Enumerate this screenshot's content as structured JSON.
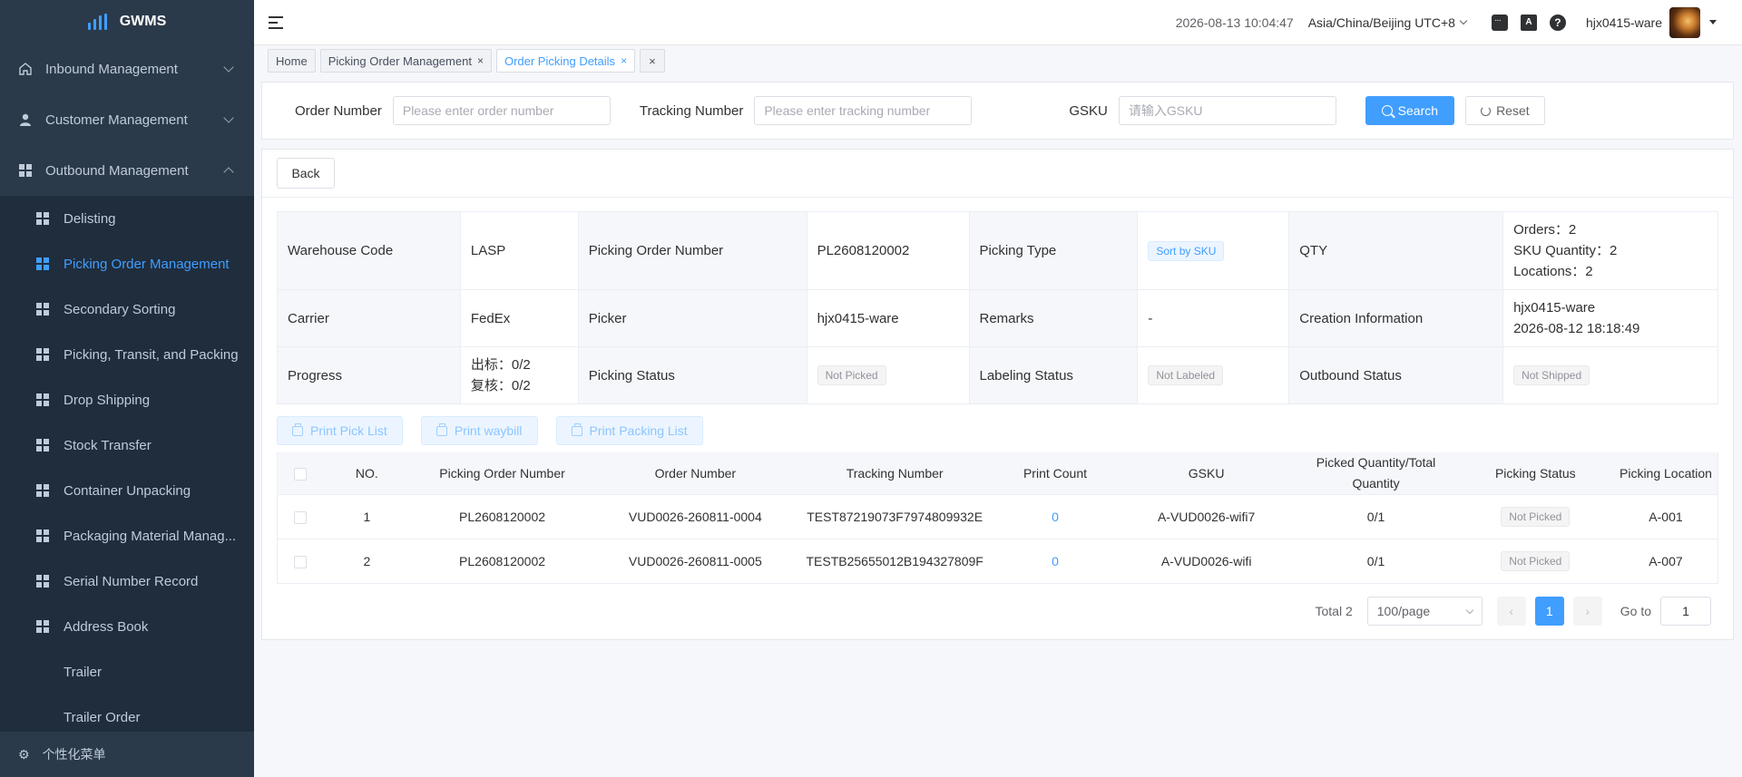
{
  "app": {
    "name": "GWMS"
  },
  "sidebar": {
    "groups": [
      {
        "label": "Inbound Management",
        "expanded": false
      },
      {
        "label": "Customer Management",
        "expanded": false
      },
      {
        "label": "Outbound Management",
        "expanded": true
      }
    ],
    "items": [
      {
        "label": "Delisting",
        "active": false
      },
      {
        "label": "Picking Order Management",
        "active": true
      },
      {
        "label": "Secondary Sorting",
        "active": false
      },
      {
        "label": "Picking, Transit, and Packing",
        "active": false
      },
      {
        "label": "Drop Shipping",
        "active": false
      },
      {
        "label": "Stock Transfer",
        "active": false
      },
      {
        "label": "Container Unpacking",
        "active": false
      },
      {
        "label": "Packaging Material Manag...",
        "active": false
      },
      {
        "label": "Serial Number Record",
        "active": false
      },
      {
        "label": "Address Book",
        "active": false
      },
      {
        "label": "Trailer",
        "active": false
      },
      {
        "label": "Trailer Order",
        "active": false
      }
    ],
    "footer": "个性化菜单"
  },
  "header": {
    "datetime": "2026-08-13 10:04:47",
    "timezone": "Asia/China/Beijing UTC+8",
    "translate_glyph": "A",
    "help_glyph": "?",
    "username": "hjx0415-ware"
  },
  "tabs": [
    {
      "label": "Home",
      "closable": false,
      "active": false
    },
    {
      "label": "Picking Order Management",
      "closable": true,
      "active": false
    },
    {
      "label": "Order Picking Details",
      "closable": true,
      "active": true
    }
  ],
  "close_glyph": "×",
  "search": {
    "order_number": {
      "label": "Order Number",
      "placeholder": "Please enter order number",
      "value": ""
    },
    "tracking_number": {
      "label": "Tracking Number",
      "placeholder": "Please enter tracking number",
      "value": ""
    },
    "gsku": {
      "label": "GSKU",
      "placeholder": "请输入GSKU",
      "value": ""
    },
    "search_label": "Search",
    "reset_label": "Reset"
  },
  "back_label": "Back",
  "details": {
    "warehouse_code": {
      "label": "Warehouse Code",
      "value": "LASP"
    },
    "picking_order_number": {
      "label": "Picking Order Number",
      "value": "PL2608120002"
    },
    "picking_type": {
      "label": "Picking Type",
      "value": "Sort by SKU"
    },
    "qty": {
      "label": "QTY",
      "lines": [
        "Orders：2",
        "SKU Quantity：2",
        "Locations：2"
      ]
    },
    "carrier": {
      "label": "Carrier",
      "value": "FedEx"
    },
    "picker": {
      "label": "Picker",
      "value": "hjx0415-ware"
    },
    "remarks": {
      "label": "Remarks",
      "value": "-"
    },
    "creation_info": {
      "label": "Creation Information",
      "lines": [
        "hjx0415-ware",
        "2026-08-12 18:18:49"
      ]
    },
    "progress": {
      "label": "Progress",
      "lines": [
        "出标：0/2",
        "复核：0/2"
      ]
    },
    "picking_status": {
      "label": "Picking Status",
      "value": "Not Picked"
    },
    "labeling_status": {
      "label": "Labeling Status",
      "value": "Not Labeled"
    },
    "outbound_status": {
      "label": "Outbound Status",
      "value": "Not Shipped"
    }
  },
  "print_buttons": [
    "Print Pick List",
    "Print waybill",
    "Print Packing List"
  ],
  "table": {
    "columns": [
      "NO.",
      "Picking Order Number",
      "Order Number",
      "Tracking Number",
      "Print Count",
      "GSKU",
      "Picked Quantity/Total Quantity",
      "Picking Status",
      "Picking Location"
    ],
    "rows": [
      {
        "no": "1",
        "picking_order_number": "PL2608120002",
        "order_number": "VUD0026-260811-0004",
        "tracking_number": "TEST87219073F7974809932E",
        "print_count": "0",
        "gsku": "A-VUD0026-wifi7",
        "picked_total": "0/1",
        "picking_status": "Not Picked",
        "picking_location": "A-001"
      },
      {
        "no": "2",
        "picking_order_number": "PL2608120002",
        "order_number": "VUD0026-260811-0005",
        "tracking_number": "TESTB25655012B194327809F",
        "print_count": "0",
        "gsku": "A-VUD0026-wifi",
        "picked_total": "0/1",
        "picking_status": "Not Picked",
        "picking_location": "A-007"
      }
    ]
  },
  "pagination": {
    "total_text": "Total 2",
    "page_size": "100/page",
    "prev_glyph": "‹",
    "next_glyph": "›",
    "current_page": "1",
    "goto_label": "Go to",
    "goto_value": "1"
  },
  "colors": {
    "primary": "#409eff",
    "sidebar_bg": "#1f2d3d",
    "sidebar_header_bg": "#2b3a4a"
  }
}
